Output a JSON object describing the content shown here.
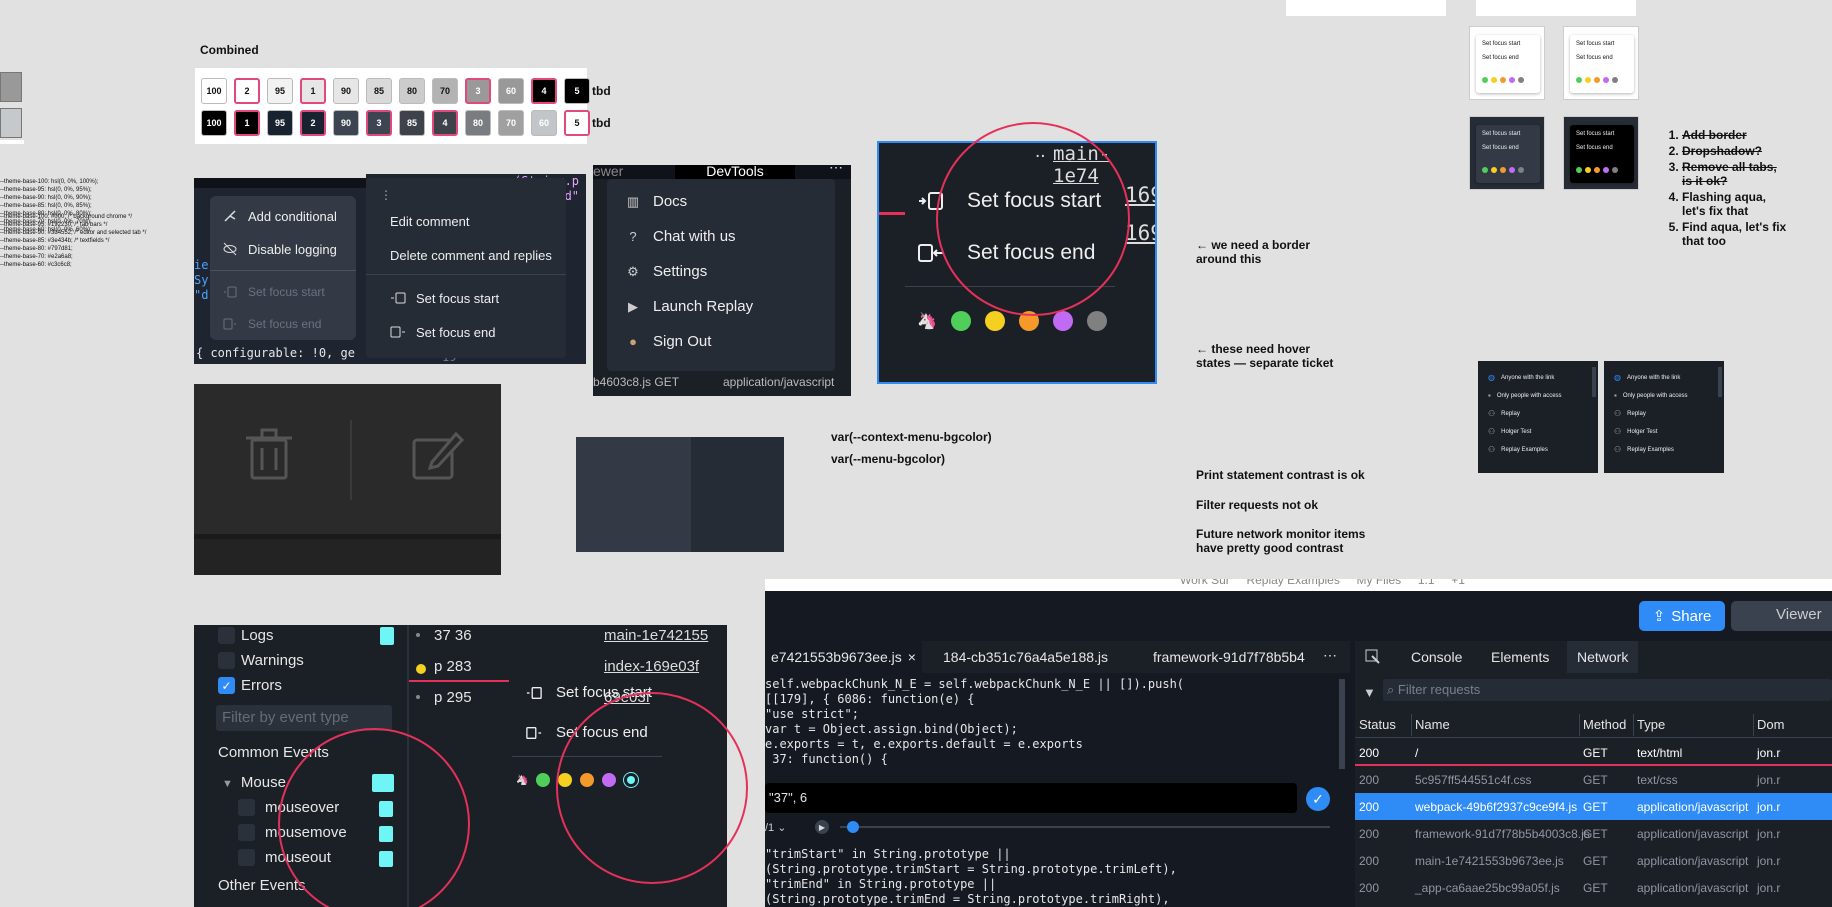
{
  "combined": {
    "title": "Combined",
    "row1": [
      "100",
      "2",
      "95",
      "1",
      "90",
      "85",
      "80",
      "70",
      "3",
      "60",
      "4",
      "5"
    ],
    "row2": [
      "100",
      "1",
      "95",
      "2",
      "90",
      "3",
      "85",
      "4",
      "80",
      "70",
      "60",
      "5"
    ],
    "tbd1": "tbd",
    "tbd2": "tbd"
  },
  "theme_vars": {
    "lines_a": [
      "--theme-base-100: hsl(0, 0%, 100%);",
      "--theme-base-95: hsl(0, 0%, 95%);",
      "--theme-base-90: hsl(0, 0%, 90%);",
      "--theme-base-85: hsl(0, 0%, 85%);",
      "--theme-base-80: hsl(0, 0%, 80%);",
      "--theme-base-70: hsl(0, 0%, 70%);",
      "--theme-base-60: hsl(0, 0%, 60%);"
    ],
    "lines_b": [
      "--theme-base-100: #000; /* background chrome */",
      "--theme-base-95: #192230; /* tab bars */",
      "--theme-base-90: #3d4552; /* editor and selected tab */",
      "--theme-base-85: #3e434b; /* textfields */",
      "--theme-base-80: #797d81;",
      "--theme-base-70: #e2a6a8;",
      "--theme-base-60: #c3c6c8;"
    ]
  },
  "context_menu_1": {
    "items": [
      "Add conditional",
      "Disable logging",
      "Set focus start",
      "Set focus end"
    ],
    "code": "{ configurable: !0, ge"
  },
  "context_menu_2": {
    "items": [
      "Edit comment",
      "Delete comment and replies",
      "Set focus start",
      "Set focus end"
    ]
  },
  "devtools_menu": {
    "header": "DevTools",
    "viewer": "ewer",
    "items": [
      "Docs",
      "Chat with us",
      "Settings",
      "Launch Replay",
      "Sign Out"
    ],
    "footer_left": "b4603c8.js   GET",
    "footer_right": "application/javascript"
  },
  "focus_zoom": {
    "file": "main-1e74",
    "start": "Set focus start",
    "end": "Set focus end",
    "num1": "169",
    "num2": "169"
  },
  "colors": {
    "dots": [
      "#4fcf5a",
      "#f5d020",
      "#f59a2a",
      "#c16bf5",
      "#808080"
    ],
    "accent": "#e5315a",
    "blue": "#2f8bf5"
  },
  "annotations": {
    "border": "← we need a border\naround this",
    "hover": "← these need hover\nstates — separate ticket",
    "ctx_var": "var(--context-menu-bgcolor)",
    "menu_var": "var(--menu-bgcolor)",
    "print": "Print statement contrast is ok",
    "filter": "Filter requests not ok",
    "future": "Future network monitor items\nhave pretty good contrast"
  },
  "todo": {
    "items": [
      {
        "text": "Add border",
        "done": true
      },
      {
        "text": "Dropshadow?",
        "done": true
      },
      {
        "text": "Remove all tabs, is it ok?",
        "done": true
      },
      {
        "text": "Flashing aqua, let's fix that",
        "done": false
      },
      {
        "text": "Find aqua, let's fix that too",
        "done": false
      }
    ]
  },
  "thumbs": {
    "start": "Set focus start",
    "end": "Set focus end"
  },
  "share_menus": {
    "items": [
      "Anyone with the link",
      "Only people with access",
      "Replay",
      "Holger Test",
      "Replay Examples"
    ]
  },
  "events_panel": {
    "filters": [
      {
        "label": "Logs",
        "checked": false
      },
      {
        "label": "Warnings",
        "checked": false
      },
      {
        "label": "Errors",
        "checked": true
      }
    ],
    "search_placeholder": "Filter by event type",
    "common": "Common Events",
    "mouse": "Mouse",
    "mouse_items": [
      "mouseover",
      "mousemove",
      "mouseout"
    ],
    "other": "Other Events",
    "console_rows": [
      {
        "left": "37 36",
        "right": "main-1e742155"
      },
      {
        "left": "p 283",
        "right": "index-169e03f"
      },
      {
        "left": "p 295",
        "right": "69e03f"
      }
    ],
    "menu_start": "Set focus start",
    "menu_end": "Set focus end"
  },
  "devtools_main": {
    "share": "Share",
    "viewer": "Viewer",
    "breadcrumb": "Work Sur     Replay Examples     My Files     1.1     +1",
    "editor_tabs": [
      "e7421553b9673ee.js",
      "184-cb351c76a4a5e188.js",
      "framework-91d7f78b5b4"
    ],
    "code_top": [
      "self.webpackChunk_N_E = self.webpackChunk_N_E || []).push(",
      "[[179], { 6086: function(e) {",
      "\"use strict\";",
      "var t = Object.assign.bind(Object);",
      "e.exports = t, e.exports.default = e.exports",
      " 37: function() {"
    ],
    "input_value": "\"37\", 6",
    "pager": "/1",
    "code_bottom": [
      "\"trimStart\" in String.prototype ||",
      "(String.prototype.trimStart = String.prototype.trimLeft),",
      "\"trimEnd\" in String.prototype ||",
      "(String.prototype.trimEnd = String.prototype.trimRight),"
    ],
    "panel_tabs": [
      "Console",
      "Elements",
      "Network"
    ],
    "filter_placeholder": "Filter requests",
    "columns": [
      "Status",
      "Name",
      "Method",
      "Type",
      "Dom"
    ],
    "rows": [
      {
        "status": "200",
        "name": "/",
        "method": "GET",
        "type": "text/html",
        "dom": "jon.r"
      },
      {
        "status": "200",
        "name": "5c957ff544551c4f.css",
        "method": "GET",
        "type": "text/css",
        "dom": "jon.r"
      },
      {
        "status": "200",
        "name": "webpack-49b6f2937c9ce9f4.js",
        "method": "GET",
        "type": "application/javascript",
        "dom": "jon.r"
      },
      {
        "status": "200",
        "name": "framework-91d7f78b5b4003c8.js",
        "method": "GET",
        "type": "application/javascript",
        "dom": "jon.r"
      },
      {
        "status": "200",
        "name": "main-1e7421553b9673ee.js",
        "method": "GET",
        "type": "application/javascript",
        "dom": "jon.r"
      },
      {
        "status": "200",
        "name": "_app-ca6aae25bc99a05f.js",
        "method": "GET",
        "type": "application/javascript",
        "dom": "jon.r"
      }
    ]
  }
}
